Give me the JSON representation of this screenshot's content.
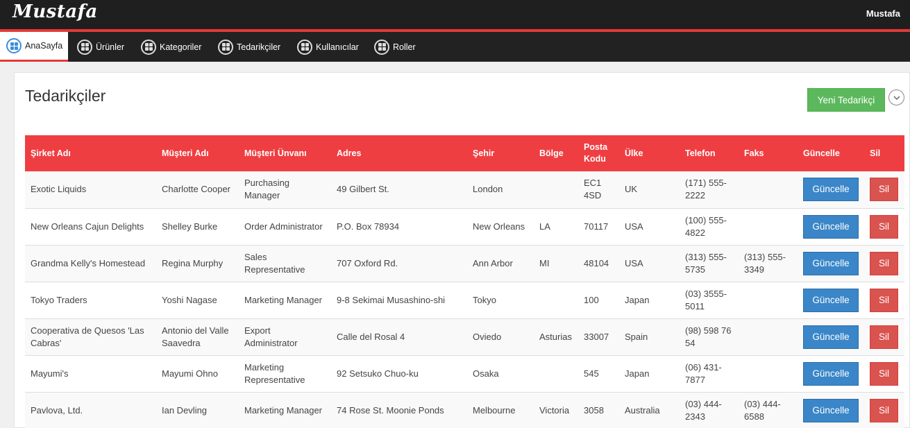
{
  "app": {
    "brand": "Mustafa",
    "user": "Mustafa"
  },
  "nav": {
    "items": [
      {
        "label": "AnaSayfa",
        "active": true
      },
      {
        "label": "Ürünler",
        "active": false
      },
      {
        "label": "Kategoriler",
        "active": false
      },
      {
        "label": "Tedarikçiler",
        "active": false
      },
      {
        "label": "Kullanıcılar",
        "active": false
      },
      {
        "label": "Roller",
        "active": false
      }
    ]
  },
  "page": {
    "title": "Tedarikçiler",
    "new_button": "Yeni Tedarikçi"
  },
  "table": {
    "headers": [
      "Şirket Adı",
      "Müşteri Adı",
      "Müşteri Ünvanı",
      "Adres",
      "Şehir",
      "Bölge",
      "Posta Kodu",
      "Ülke",
      "Telefon",
      "Faks",
      "Güncelle",
      "Sil"
    ],
    "update_label": "Güncelle",
    "delete_label": "Sil",
    "rows": [
      [
        "Exotic Liquids",
        "Charlotte Cooper",
        "Purchasing Manager",
        "49 Gilbert St.",
        "London",
        "",
        "EC1 4SD",
        "UK",
        "(171) 555-2222",
        ""
      ],
      [
        "New Orleans Cajun Delights",
        "Shelley Burke",
        "Order Administrator",
        "P.O. Box 78934",
        "New Orleans",
        "LA",
        "70117",
        "USA",
        "(100) 555-4822",
        ""
      ],
      [
        "Grandma Kelly's Homestead",
        "Regina Murphy",
        "Sales Representative",
        "707 Oxford Rd.",
        "Ann Arbor",
        "MI",
        "48104",
        "USA",
        "(313) 555-5735",
        "(313) 555-3349"
      ],
      [
        "Tokyo Traders",
        "Yoshi Nagase",
        "Marketing Manager",
        "9-8 Sekimai Musashino-shi",
        "Tokyo",
        "",
        "100",
        "Japan",
        "(03) 3555-5011",
        ""
      ],
      [
        "Cooperativa de Quesos 'Las Cabras'",
        "Antonio del Valle Saavedra",
        "Export Administrator",
        "Calle del Rosal 4",
        "Oviedo",
        "Asturias",
        "33007",
        "Spain",
        "(98) 598 76 54",
        ""
      ],
      [
        "Mayumi's",
        "Mayumi Ohno",
        "Marketing Representative",
        "92 Setsuko Chuo-ku",
        "Osaka",
        "",
        "545",
        "Japan",
        "(06) 431-7877",
        ""
      ],
      [
        "Pavlova, Ltd.",
        "Ian Devling",
        "Marketing Manager",
        "74 Rose St. Moonie Ponds",
        "Melbourne",
        "Victoria",
        "3058",
        "Australia",
        "(03) 444-2343",
        "(03) 444-6588"
      ]
    ]
  },
  "colors": {
    "accent": "#e53935",
    "header_bg": "#ef3e42",
    "update": "#3a86c8",
    "delete": "#d9534f",
    "new": "#5cb85c"
  }
}
